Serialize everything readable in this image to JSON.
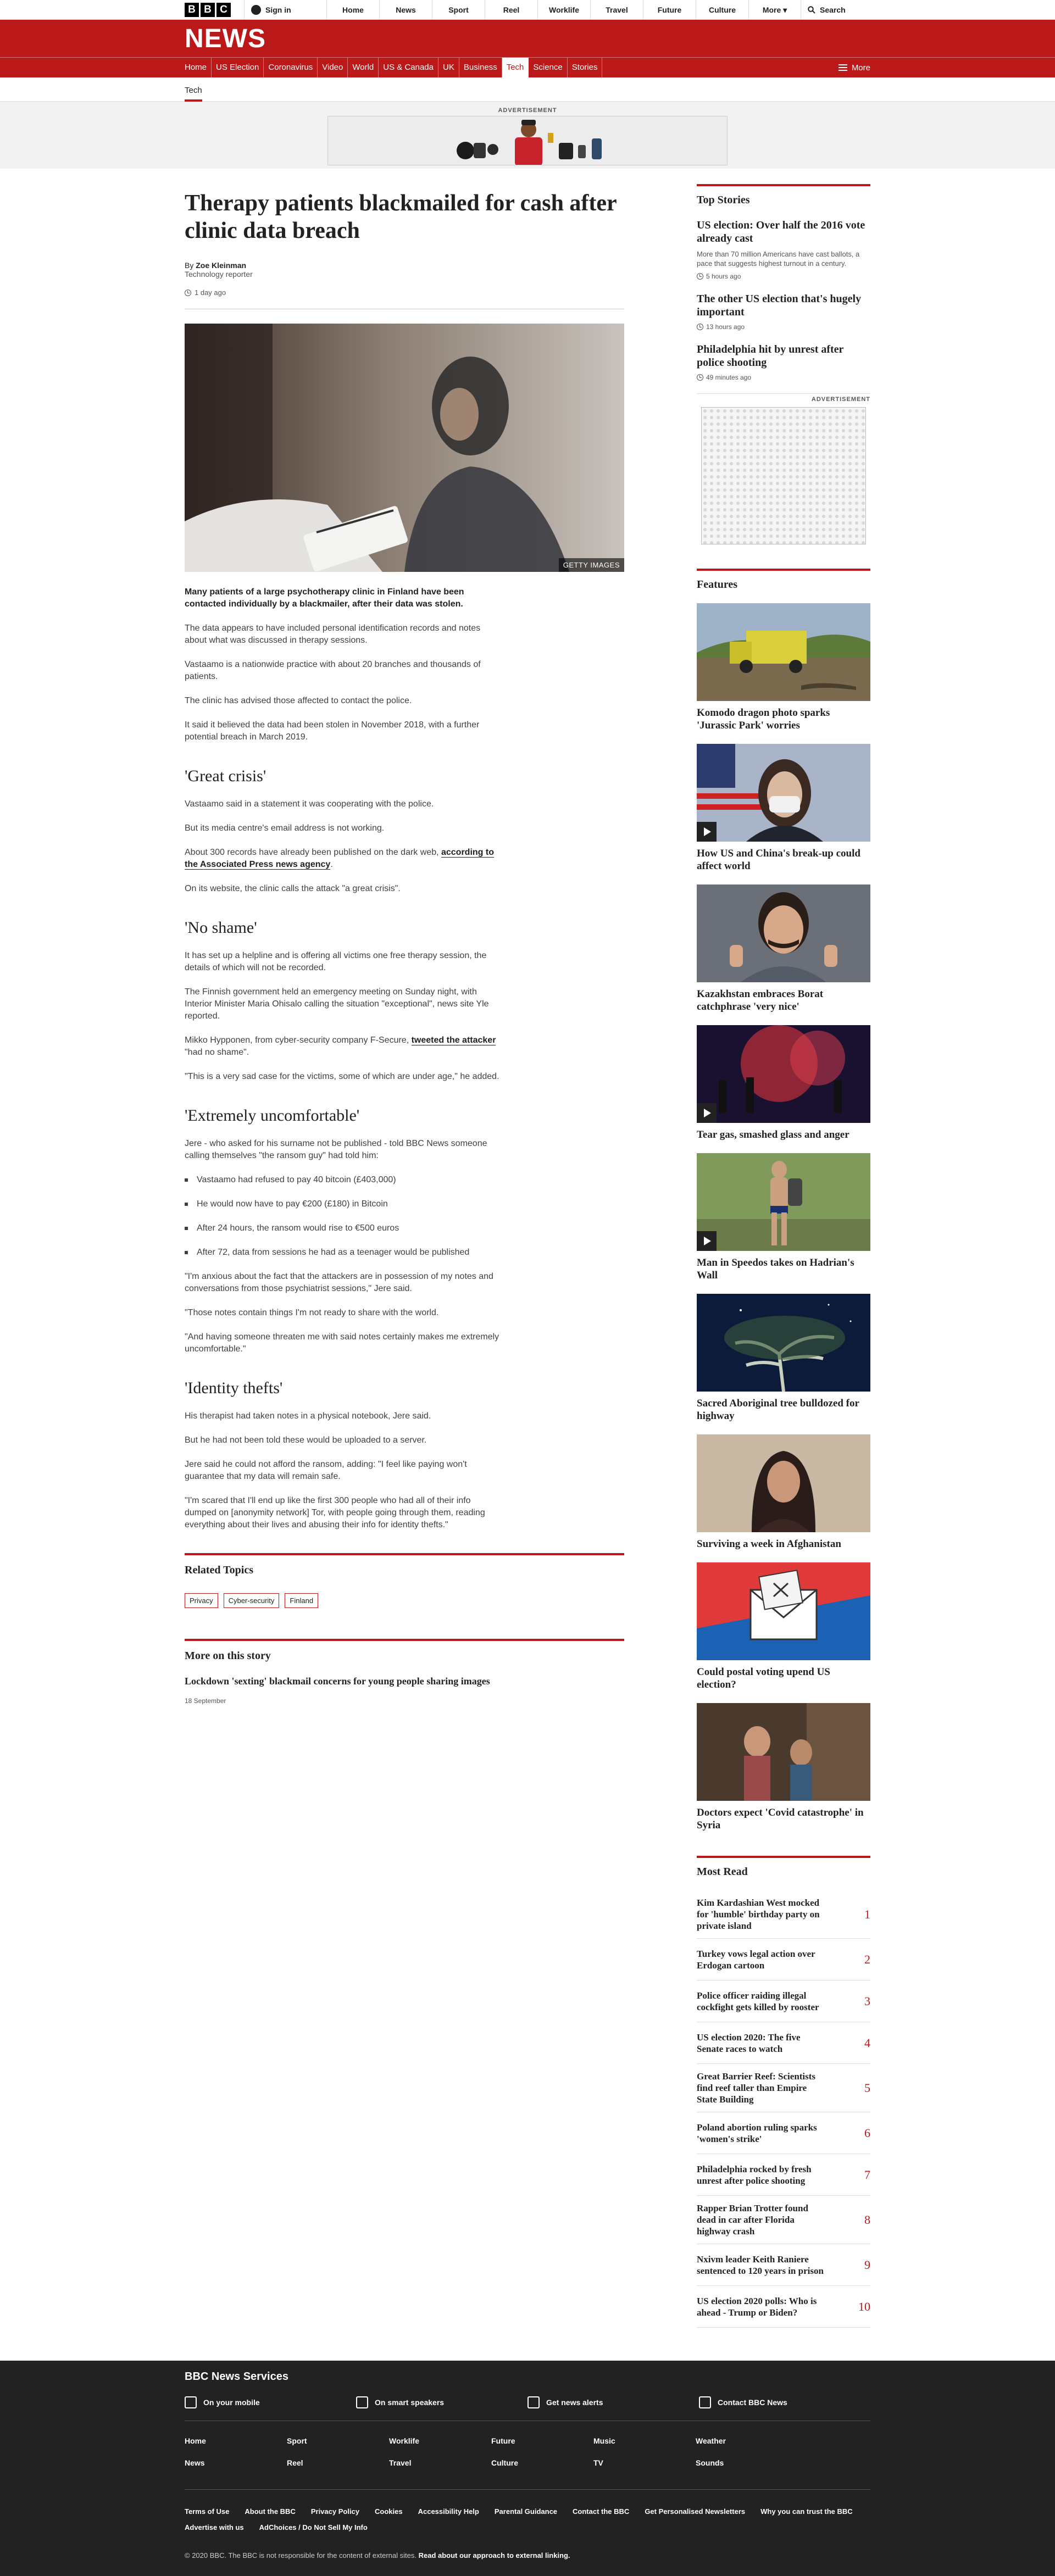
{
  "global_nav": {
    "logo": [
      "B",
      "B",
      "C"
    ],
    "signin": "Sign in",
    "items": [
      "Home",
      "News",
      "Sport",
      "Reel",
      "Worklife",
      "Travel",
      "Future",
      "Culture"
    ],
    "more": "More",
    "search": "Search"
  },
  "masthead": {
    "title": "NEWS",
    "nav": [
      "Home",
      "US Election",
      "Coronavirus",
      "Video",
      "World",
      "US & Canada",
      "UK",
      "Business",
      "Tech",
      "Science",
      "Stories"
    ],
    "active": "Tech",
    "more": "More",
    "subnav": "Tech"
  },
  "advert": {
    "label": "ADVERTISEMENT"
  },
  "article": {
    "title": "Therapy patients blackmailed for cash after clinic data breach",
    "byline": {
      "prefix": "By",
      "author": "Zoe Kleinman",
      "role": "Technology reporter"
    },
    "timestamp": "1 day ago",
    "image_credit": "GETTY IMAGES",
    "intro": "Many patients of a large psychotherapy clinic in Finland have been contacted individually by a blackmailer, after their data was stolen.",
    "p1": "The data appears to have included personal identification records and notes about what was discussed in therapy sessions.",
    "p2": "Vastaamo is a nationwide practice with about 20 branches and thousands of patients.",
    "p3": "The clinic has advised those affected to contact the police.",
    "p4": "It said it believed the data had been stolen in November 2018, with a further potential breach in March 2019.",
    "h_great": "'Great crisis'",
    "p5": "Vastaamo said in a statement it was cooperating with the police.",
    "p6": "But its media centre's email address is not working.",
    "p7_pre": "About 300 records have already been published on the dark web, ",
    "p7_link": "according to the Associated Press news agency",
    "p7_post": ".",
    "p8": "On its website, the clinic calls the attack \"a great crisis\".",
    "h_shame": "'No shame'",
    "p9": "It has set up a helpline and is offering all victims one free therapy session, the details of which will not be recorded.",
    "p10": "The Finnish government held an emergency meeting on Sunday night, with Interior Minister Maria Ohisalo calling the situation \"exceptional\", news site Yle reported.",
    "p11_pre": "Mikko Hypponen, from cyber-security company F-Secure, ",
    "p11_link": "tweeted the attacker",
    "p11_post": " \"had no shame\".",
    "p12": "\"This is a very sad case for the victims, some of which are under age,\" he added.",
    "h_uncomf": "'Extremely uncomfortable'",
    "p13": "Jere - who asked for his surname not be published - told BBC News someone calling themselves \"the ransom guy\" had told him:",
    "bullets": [
      "Vastaamo had refused to pay 40 bitcoin (£403,000)",
      "He would now have to pay €200 (£180) in Bitcoin",
      "After 24 hours, the ransom would rise to €500 euros",
      "After 72, data from sessions he had as a teenager would be published"
    ],
    "p14": "\"I'm anxious about the fact that the attackers are in possession of my notes and conversations from those psychiatrist sessions,\" Jere said.",
    "p15": "\"Those notes contain things I'm not ready to share with the world.",
    "p16": "\"And having someone threaten me with said notes certainly makes me extremely uncomfortable.\"",
    "h_identity": "'Identity thefts'",
    "p17": "His therapist had taken notes in a physical notebook, Jere said.",
    "p18": "But he had not been told these would be uploaded to a server.",
    "p19": "Jere said he could not afford the ransom, adding: \"I feel like paying won't guarantee that my data will remain safe.",
    "p20": "\"I'm scared that I'll end up like the first 300 people who had all of their info dumped on [anonymity network] Tor, with people going through them, reading everything about their lives and abusing their info for identity thefts.\""
  },
  "related": {
    "heading": "Related Topics",
    "tags": [
      "Privacy",
      "Cyber-security",
      "Finland"
    ]
  },
  "more_story": {
    "heading": "More on this story",
    "title": "Lockdown 'sexting' blackmail concerns for young people sharing images",
    "date": "18 September"
  },
  "top_stories": {
    "heading": "Top Stories",
    "items": [
      {
        "title": "US election: Over half the 2016 vote already cast",
        "summary": "More than 70 million Americans have cast ballots, a pace that suggests highest turnout in a century.",
        "time": "5 hours ago"
      },
      {
        "title": "The other US election that's hugely important",
        "summary": "",
        "time": "13 hours ago"
      },
      {
        "title": "Philadelphia hit by unrest after police shooting",
        "summary": "",
        "time": "49 minutes ago"
      }
    ]
  },
  "side_advert": {
    "label": "ADVERTISEMENT"
  },
  "features": {
    "heading": "Features",
    "items": [
      {
        "title": "Komodo dragon photo sparks 'Jurassic Park' worries",
        "video": false
      },
      {
        "title": "How US and China's break-up could affect world",
        "video": true
      },
      {
        "title": "Kazakhstan embraces Borat catchphrase 'very nice'",
        "video": false
      },
      {
        "title": "Tear gas, smashed glass and anger",
        "video": true
      },
      {
        "title": "Man in Speedos takes on Hadrian's Wall",
        "video": true
      },
      {
        "title": "Sacred Aboriginal tree bulldozed for highway",
        "video": false
      },
      {
        "title": "Surviving a week in Afghanistan",
        "video": false
      },
      {
        "title": "Could postal voting upend US election?",
        "video": false
      },
      {
        "title": "Doctors expect 'Covid catastrophe' in Syria",
        "video": false
      }
    ]
  },
  "most_read": {
    "heading": "Most Read",
    "items": [
      {
        "title": "Kim Kardashian West mocked for 'humble' birthday party on private island",
        "rank": "1"
      },
      {
        "title": "Turkey vows legal action over Erdogan cartoon",
        "rank": "2"
      },
      {
        "title": "Police officer raiding illegal cockfight gets killed by rooster",
        "rank": "3"
      },
      {
        "title": "US election 2020: The five Senate races to watch",
        "rank": "4"
      },
      {
        "title": "Great Barrier Reef: Scientists find reef taller than Empire State Building",
        "rank": "5"
      },
      {
        "title": "Poland abortion ruling sparks 'women's strike'",
        "rank": "6"
      },
      {
        "title": "Philadelphia rocked by fresh unrest after police shooting",
        "rank": "7"
      },
      {
        "title": "Rapper Brian Trotter found dead in car after Florida highway crash",
        "rank": "8"
      },
      {
        "title": "Nxivm leader Keith Raniere sentenced to 120 years in prison",
        "rank": "9"
      },
      {
        "title": "US election 2020 polls: Who is ahead - Trump or Biden?",
        "rank": "10"
      }
    ]
  },
  "footer": {
    "heading": "BBC News Services",
    "services": [
      "On your mobile",
      "On smart speakers",
      "Get news alerts",
      "Contact BBC News"
    ],
    "links": [
      "Home",
      "Sport",
      "Worklife",
      "Future",
      "Music",
      "Weather",
      "News",
      "Reel",
      "Travel",
      "Culture",
      "TV",
      "Sounds"
    ],
    "legal": [
      "Terms of Use",
      "About the BBC",
      "Privacy Policy",
      "Cookies",
      "Accessibility Help",
      "Parental Guidance",
      "Contact the BBC",
      "Get Personalised Newsletters",
      "Why you can trust the BBC",
      "Advertise with us",
      "AdChoices / Do Not Sell My Info"
    ],
    "copyright": "© 2020 BBC. The BBC is not responsible for the content of external sites.",
    "copyright_link": "Read about our approach to external linking."
  }
}
